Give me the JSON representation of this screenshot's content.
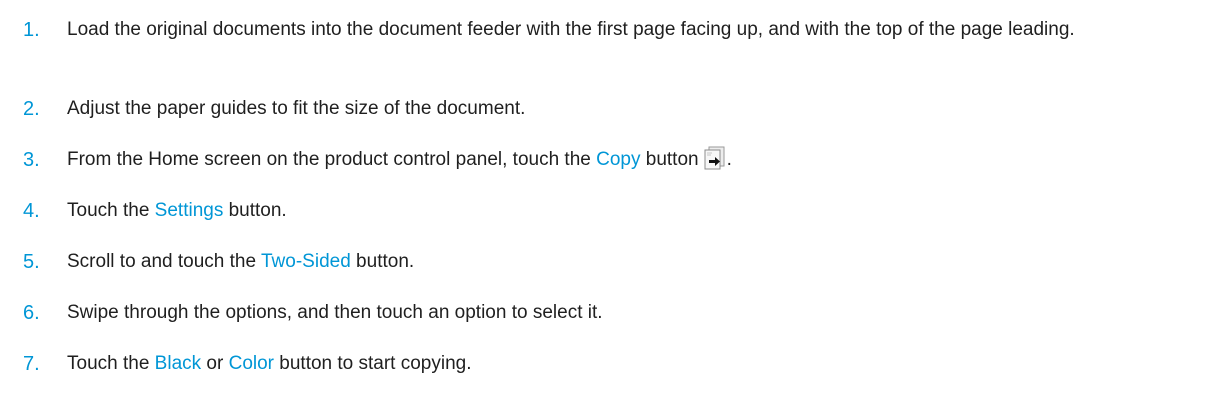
{
  "steps": [
    {
      "number": "1.",
      "text": "Load the original documents into the document feeder with the first page facing up, and with the top of the page leading."
    },
    {
      "number": "2.",
      "text": "Adjust the paper guides to fit the size of the document."
    },
    {
      "number": "3.",
      "before": "From the Home screen on the product control panel, touch the ",
      "term": "Copy",
      "after": " button",
      "end": ".",
      "icon": "copy-icon"
    },
    {
      "number": "4.",
      "before": "Touch the ",
      "term": "Settings",
      "after": " button."
    },
    {
      "number": "5.",
      "before": "Scroll to and touch the ",
      "term": "Two-Sided",
      "after": " button."
    },
    {
      "number": "6.",
      "text": "Swipe through the options, and then touch an option to select it."
    },
    {
      "number": "7.",
      "before": "Touch the ",
      "term": "Black",
      "middle": " or ",
      "term2": "Color",
      "after": " button to start copying."
    }
  ],
  "colors": {
    "accent": "#0096d6",
    "text": "#1f1f1f"
  }
}
